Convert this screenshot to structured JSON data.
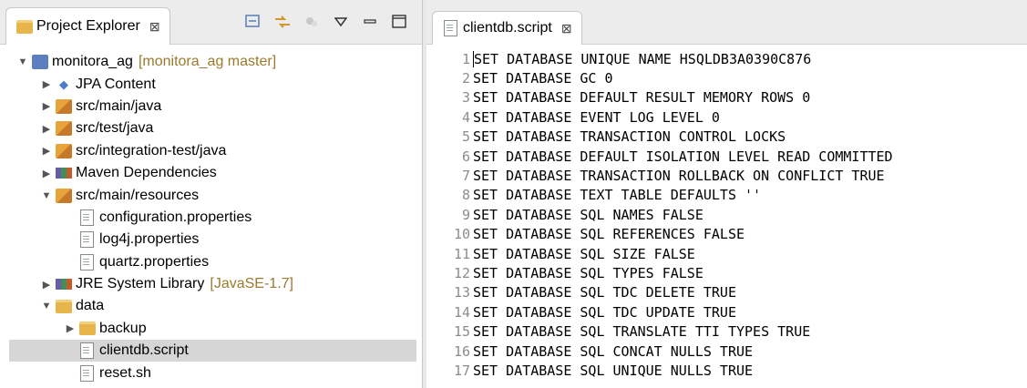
{
  "explorer": {
    "title": "Project Explorer",
    "close": "⊠",
    "items": [
      {
        "indent": 0,
        "arrow": "▼",
        "icon": "ico-proj",
        "label": "monitora_ag",
        "deco": "[monitora_ag master]"
      },
      {
        "indent": 1,
        "arrow": "▶",
        "icon": "ico-jpa",
        "label": "JPA Content",
        "deco": ""
      },
      {
        "indent": 1,
        "arrow": "▶",
        "icon": "ico-pkg",
        "label": "src/main/java",
        "deco": ""
      },
      {
        "indent": 1,
        "arrow": "▶",
        "icon": "ico-pkg",
        "label": "src/test/java",
        "deco": ""
      },
      {
        "indent": 1,
        "arrow": "▶",
        "icon": "ico-pkg",
        "label": "src/integration-test/java",
        "deco": ""
      },
      {
        "indent": 1,
        "arrow": "▶",
        "icon": "ico-lib",
        "label": "Maven Dependencies",
        "deco": ""
      },
      {
        "indent": 1,
        "arrow": "▼",
        "icon": "ico-pkg",
        "label": "src/main/resources",
        "deco": ""
      },
      {
        "indent": 2,
        "arrow": "",
        "icon": "ico-file",
        "label": "configuration.properties",
        "deco": ""
      },
      {
        "indent": 2,
        "arrow": "",
        "icon": "ico-file",
        "label": "log4j.properties",
        "deco": ""
      },
      {
        "indent": 2,
        "arrow": "",
        "icon": "ico-file",
        "label": "quartz.properties",
        "deco": ""
      },
      {
        "indent": 1,
        "arrow": "▶",
        "icon": "ico-lib",
        "label": "JRE System Library",
        "deco": "[JavaSE-1.7]"
      },
      {
        "indent": 1,
        "arrow": "▼",
        "icon": "ico-folder",
        "label": "data",
        "deco": ""
      },
      {
        "indent": 2,
        "arrow": "▶",
        "icon": "ico-folder",
        "label": "backup",
        "deco": ""
      },
      {
        "indent": 2,
        "arrow": "",
        "icon": "ico-file",
        "label": "clientdb.script",
        "deco": "",
        "selected": true
      },
      {
        "indent": 2,
        "arrow": "",
        "icon": "ico-file",
        "label": "reset.sh",
        "deco": ""
      }
    ]
  },
  "editor": {
    "tab_title": "clientdb.script",
    "close": "⊠",
    "lines": [
      {
        "n": "1",
        "text": "SET DATABASE UNIQUE NAME HSQLDB3A0390C876"
      },
      {
        "n": "2",
        "text": "SET DATABASE GC 0"
      },
      {
        "n": "3",
        "text": "SET DATABASE DEFAULT RESULT MEMORY ROWS 0"
      },
      {
        "n": "4",
        "text": "SET DATABASE EVENT LOG LEVEL 0"
      },
      {
        "n": "5",
        "text": "SET DATABASE TRANSACTION CONTROL LOCKS"
      },
      {
        "n": "6",
        "text": "SET DATABASE DEFAULT ISOLATION LEVEL READ COMMITTED"
      },
      {
        "n": "7",
        "text": "SET DATABASE TRANSACTION ROLLBACK ON CONFLICT TRUE"
      },
      {
        "n": "8",
        "text": "SET DATABASE TEXT TABLE DEFAULTS ''"
      },
      {
        "n": "9",
        "text": "SET DATABASE SQL NAMES FALSE"
      },
      {
        "n": "10",
        "text": "SET DATABASE SQL REFERENCES FALSE"
      },
      {
        "n": "11",
        "text": "SET DATABASE SQL SIZE FALSE"
      },
      {
        "n": "12",
        "text": "SET DATABASE SQL TYPES FALSE"
      },
      {
        "n": "13",
        "text": "SET DATABASE SQL TDC DELETE TRUE"
      },
      {
        "n": "14",
        "text": "SET DATABASE SQL TDC UPDATE TRUE"
      },
      {
        "n": "15",
        "text": "SET DATABASE SQL TRANSLATE TTI TYPES TRUE"
      },
      {
        "n": "16",
        "text": "SET DATABASE SQL CONCAT NULLS TRUE"
      },
      {
        "n": "17",
        "text": "SET DATABASE SQL UNIQUE NULLS TRUE"
      }
    ]
  }
}
